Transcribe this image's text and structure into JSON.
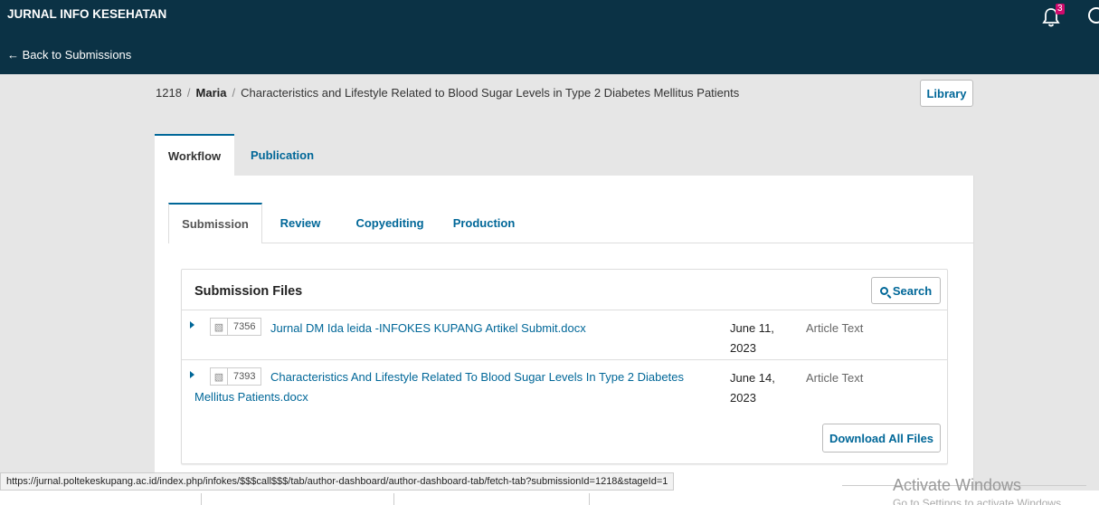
{
  "header": {
    "journal_title": "JURNAL INFO KESEHATAN",
    "back_link": "← Back to Submissions",
    "notification_count": "3"
  },
  "breadcrumb": {
    "id": "1218",
    "author": "Maria",
    "title": "Characteristics and Lifestyle Related to Blood Sugar Levels in Type 2 Diabetes Mellitus Patients",
    "library_label": "Library"
  },
  "main_tabs": [
    {
      "label": "Workflow"
    },
    {
      "label": "Publication"
    }
  ],
  "stage_tabs": [
    {
      "label": "Submission"
    },
    {
      "label": "Review"
    },
    {
      "label": "Copyediting"
    },
    {
      "label": "Production"
    }
  ],
  "files_panel": {
    "title": "Submission Files",
    "search_label": "Search",
    "download_all_label": "Download All Files",
    "files": [
      {
        "id": "7356",
        "name": "Jurnal DM Ida leida -INFOKES KUPANG Artikel Submit.docx",
        "date": "June 11, 2023",
        "type": "Article Text"
      },
      {
        "id": "7393",
        "name": "Characteristics And Lifestyle Related To Blood Sugar Levels In Type 2 Diabetes Mellitus Patients.docx",
        "date": "June 14, 2023",
        "type": "Article Text"
      }
    ]
  },
  "status_bar": {
    "url": "https://jurnal.poltekeskupang.ac.id/index.php/infokes/$$$call$$$/tab/author-dashboard/author-dashboard-tab/fetch-tab?submissionId=1218&stageId=1"
  },
  "watermark": {
    "title": "Activate Windows",
    "subtitle": "Go to Settings to activate Windows."
  },
  "colors": {
    "header_bg": "#0b3245",
    "accent": "#006798",
    "badge": "#d00a6c"
  }
}
